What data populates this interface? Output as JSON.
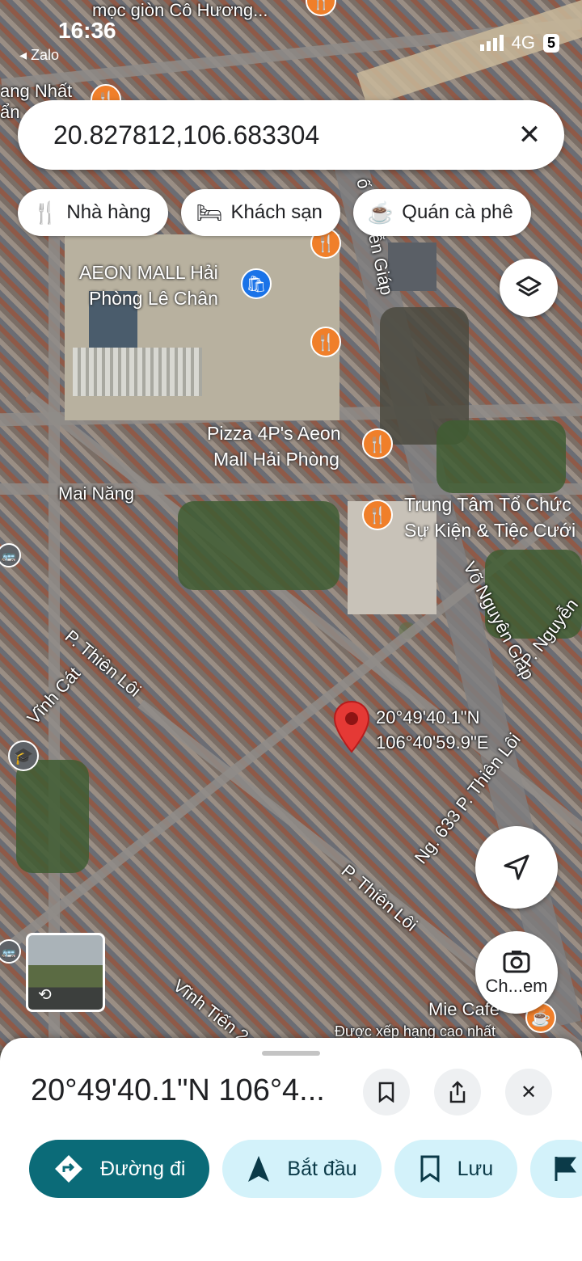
{
  "status_bar": {
    "time": "16:36",
    "back_app": "◂ Zalo",
    "network": "4G",
    "battery": "5"
  },
  "search": {
    "query": "20.827812,106.683304"
  },
  "chips": [
    {
      "icon": "fork-knife-icon",
      "label": "Nhà hàng"
    },
    {
      "icon": "bed-icon",
      "label": "Khách sạn"
    },
    {
      "icon": "coffee-cup-icon",
      "label": "Quán cà phê"
    }
  ],
  "map": {
    "top_label": "mọc giòn Cô Hương...",
    "partial_label": "ang Nhất",
    "partial_label2": "ẩn",
    "aeon_line1": "AEON MALL Hải",
    "aeon_line2": "Phòng Lê Chân",
    "pizza_line1": "Pizza 4P's Aeon",
    "pizza_line2": "Mall Hải Phòng",
    "event_line1": "Trung Tâm Tổ Chức",
    "event_line2": "Sự Kiện & Tiệc Cưới",
    "street_mai_nang": "Mai Năng",
    "street_vo_nguyen_giap": "Võ Nguyên Giáp",
    "street_nguyen_giap_top": "ố Nguyễn Giáp",
    "street_thien_loi_left": "P. Thiên Lôi",
    "street_vinh_cat": "Vĩnh Cát",
    "street_thien_loi_center": "P. Thiên Lôi",
    "street_ng633": "Ng. 633 P. Thiên Lôi",
    "street_p_nguyen": "P. Nguyễn",
    "street_vinh_tien": "Vĩnh Tiến 2",
    "mie_cafe": "Mie Cafe",
    "top_rated": "Được xếp hạng cao nhất",
    "pin_lat": "20°49'40.1\"N",
    "pin_lng": "106°40'59.9\"E",
    "camera_button_label": "Ch...em"
  },
  "sheet": {
    "title": "20°49'40.1\"N 106°4...",
    "actions": [
      {
        "label": "Đường đi"
      },
      {
        "label": "Bắt đầu"
      },
      {
        "label": "Lưu"
      }
    ]
  },
  "colors": {
    "primary_action": "#0b6b78",
    "secondary_action": "#d3f2fa",
    "pin": "#e53935",
    "poi_orange": "#f07f2a"
  }
}
